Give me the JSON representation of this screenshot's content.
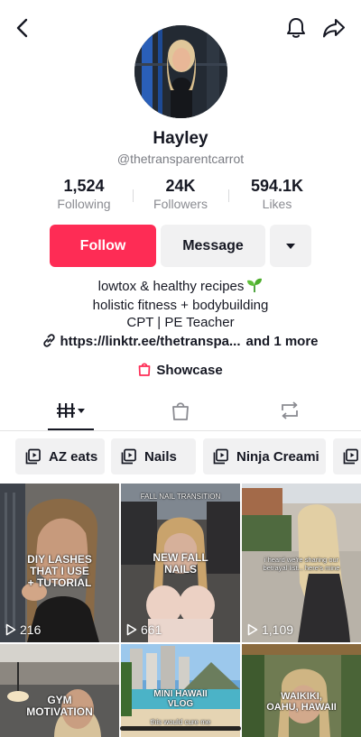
{
  "profile": {
    "display_name": "Hayley",
    "username": "@thetransparentcarrot"
  },
  "stats": {
    "following": {
      "value": "1,524",
      "label": "Following"
    },
    "followers": {
      "value": "24K",
      "label": "Followers"
    },
    "likes": {
      "value": "594.1K",
      "label": "Likes"
    }
  },
  "actions": {
    "follow_label": "Follow",
    "message_label": "Message"
  },
  "bio": {
    "line1": "lowtox & healthy recipes",
    "line2": "holistic fitness + bodybuilding",
    "line3": "CPT | PE Teacher"
  },
  "link": {
    "url": "https://linktr.ee/thetranspa...",
    "more": "and 1 more"
  },
  "showcase": {
    "label": "Showcase"
  },
  "playlists": [
    {
      "label": "AZ eats"
    },
    {
      "label": "Nails"
    },
    {
      "label": "Ninja Creami"
    },
    {
      "label": ""
    }
  ],
  "videos": [
    {
      "caption": "DIY LASHES\nTHAT I USE\n+ TUTORIAL",
      "views": "216"
    },
    {
      "overlay_top": "FALL NAIL TRANSITION",
      "caption": "NEW FALL\nNAILS",
      "views": "661"
    },
    {
      "caption": "i heard we're sharing our\nbetrayal list... here's mine",
      "views": "1,109"
    },
    {
      "caption": "GYM\nMOTIVATION",
      "views": ""
    },
    {
      "caption": "MINI HAWAII\nVLOG",
      "subcaption": "this would cure me",
      "views": ""
    },
    {
      "caption": "WAIKIKI,\nOAHU, HAWAII",
      "views": ""
    }
  ],
  "colors": {
    "accent": "#fe2c55",
    "text": "#161823",
    "muted": "#8a8b91",
    "chip_bg": "#f1f1f2"
  },
  "icons": [
    "back-arrow-icon",
    "bell-icon",
    "share-icon",
    "chevron-down-icon",
    "link-icon",
    "shopping-bag-icon",
    "grid-icon",
    "repost-icon",
    "playlist-icon",
    "play-icon",
    "sprout-emoji"
  ]
}
